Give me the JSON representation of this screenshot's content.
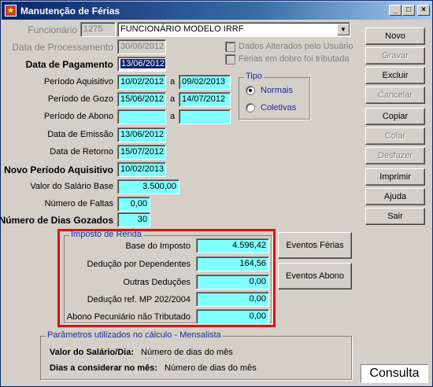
{
  "window": {
    "title": "Manutenção de Férias",
    "minimize": "_",
    "maximize": "□",
    "close": "×"
  },
  "funcionario": {
    "label": "Funcionário",
    "code": "1275",
    "name": "FUNCIONÁRIO MODELO IRRF"
  },
  "data_processamento": {
    "label": "Data de Processamento",
    "value": "30/06/2012"
  },
  "data_pagamento": {
    "label": "Data de Pagamento",
    "value": "13/06/2012"
  },
  "checkboxes": [
    {
      "label": "Dados Alterados pelo Usuário",
      "checked": false
    },
    {
      "label": "Férias em dobro foi tributada",
      "checked": false
    }
  ],
  "periodo_aquisitivo": {
    "label": "Período Aquisitivo",
    "from": "10/02/2012",
    "sep": "a",
    "to": "09/02/2013"
  },
  "periodo_gozo": {
    "label": "Período de Gozo",
    "from": "15/06/2012",
    "sep": "a",
    "to": "14/07/2012"
  },
  "periodo_abono": {
    "label": "Período de Abono",
    "from": "",
    "sep": "a",
    "to": ""
  },
  "tipo": {
    "caption": "Tipo",
    "options": [
      {
        "label": "Normais",
        "selected": true
      },
      {
        "label": "Coletivas",
        "selected": false
      }
    ]
  },
  "data_emissao": {
    "label": "Data de Emissão",
    "value": "13/06/2012"
  },
  "data_retorno": {
    "label": "Data de Retorno",
    "value": "15/07/2012"
  },
  "novo_periodo": {
    "label": "Novo Período Aquisitivo",
    "value": "10/02/2013"
  },
  "salario_base": {
    "label": "Valor do Salário Base",
    "value": "3.500,00"
  },
  "numero_faltas": {
    "label": "Número de Faltas",
    "value": "0,00"
  },
  "dias_gozados": {
    "label": "Número de Dias Gozados",
    "value": "30"
  },
  "imposto": {
    "caption": "Imposto de Renda",
    "rows": [
      {
        "label": "Base do Imposto",
        "value": "4.596,42"
      },
      {
        "label": "Dedução por Dependentes",
        "value": "164,56"
      },
      {
        "label": "Outras Deduções",
        "value": "0,00"
      },
      {
        "label": "Dedução ref. MP 202/2004",
        "value": "0,00"
      },
      {
        "label": "Abono Pecuniário não Tributado",
        "value": "0,00"
      }
    ]
  },
  "eventos": {
    "ferias": "Eventos Férias",
    "abono": "Eventos Abono"
  },
  "parametros": {
    "caption": "Parâmetros utilizados no cálculo - Mensalista",
    "salario_dia_label": "Valor do Salário/Dia:",
    "salario_dia_value": "Número de dias do mês",
    "dias_mes_label": "Dias a considerar no mês:",
    "dias_mes_value": "Número de dias do mês"
  },
  "buttons": [
    {
      "label": "Novo",
      "enabled": true
    },
    {
      "label": "Gravar",
      "enabled": false
    },
    {
      "label": "Excluir",
      "enabled": true
    },
    {
      "label": "Cancelar",
      "enabled": false
    },
    {
      "label": "Copiar",
      "enabled": true
    },
    {
      "label": "Colar",
      "enabled": false
    },
    {
      "label": "Desfazer",
      "enabled": false
    },
    {
      "label": "Imprimir",
      "enabled": true
    },
    {
      "label": "Ajuda",
      "enabled": true
    },
    {
      "label": "Sair",
      "enabled": true
    }
  ],
  "mode": "Consulta",
  "colors": {
    "field": "#80ffff",
    "highlight": "#e0101a",
    "caption": "#1a2aa0"
  }
}
